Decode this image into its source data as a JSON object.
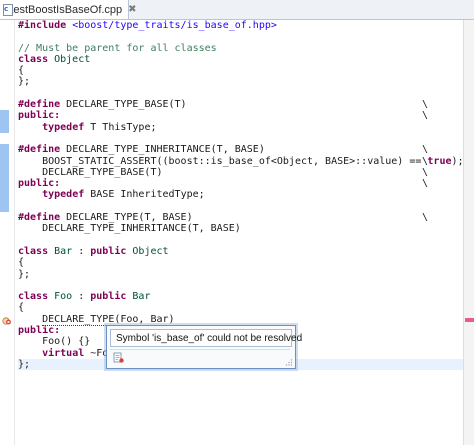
{
  "tab": {
    "title": "*testBoostIsBaseOf.cpp",
    "close_glyph": "✖"
  },
  "code": {
    "l1": {
      "kw": "#include ",
      "str": "<boost/type_traits/is_base_of.hpp>"
    },
    "l3": {
      "cm": "// Must be parent for all classes"
    },
    "l4": {
      "kw": "class ",
      "name": "Object"
    },
    "l5": {
      "text": "{"
    },
    "l6": {
      "text": "};"
    },
    "l8": {
      "kw": "#define ",
      "text": "DECLARE_TYPE_BASE(T)",
      "bs": "\\"
    },
    "l9": {
      "kw": "public:",
      "bs": "\\"
    },
    "l10": {
      "pre": "    ",
      "kw": "typedef",
      "text": " T ThisType;"
    },
    "l12": {
      "kw": "#define ",
      "text": "DECLARE_TYPE_INHERITANCE(T, BASE)",
      "bs": "\\"
    },
    "l13": {
      "pre": "    BOOST_STATIC_ASSERT((boost::is_base_of<Object, BASE>::value) == ",
      "kw": "true",
      "post": ");",
      "bs": "\\"
    },
    "l14": {
      "text": "    DECLARE_TYPE_BASE(T)",
      "bs": "\\"
    },
    "l15": {
      "kw": "public:",
      "bs": "\\"
    },
    "l16": {
      "pre": "    ",
      "kw": "typedef",
      "text": " BASE InheritedType;"
    },
    "l18": {
      "kw": "#define ",
      "text": "DECLARE_TYPE(T, BASE)",
      "bs": "\\"
    },
    "l19": {
      "text": "    DECLARE_TYPE_INHERITANCE(T, BASE)"
    },
    "l21": {
      "kw": "class ",
      "name": "Bar",
      "mid": " : ",
      "kw2": "public ",
      "name2": "Object"
    },
    "l22": {
      "text": "{"
    },
    "l23": {
      "text": "};"
    },
    "l25": {
      "kw": "class ",
      "name": "Foo",
      "mid": " : ",
      "kw2": "public ",
      "name2": "Bar"
    },
    "l26": {
      "text": "{"
    },
    "l27": {
      "pre": "    ",
      "err": "DECLARE_TYPE",
      "post": "(Foo, Bar)"
    },
    "l28": {
      "kw": "public:"
    },
    "l29": {
      "text": "    Foo() {}"
    },
    "l30": {
      "pre": "    ",
      "kw": "virtual",
      "text": " ~Foo"
    },
    "l31": {
      "text": "};"
    }
  },
  "tooltip": {
    "message": "Symbol 'is_base_of' could not be resolved"
  },
  "colors": {
    "keyword": "#7f0055",
    "comment": "#3f7f5f",
    "string": "#2a00ff",
    "type": "#005032",
    "error": "#e75d88"
  }
}
